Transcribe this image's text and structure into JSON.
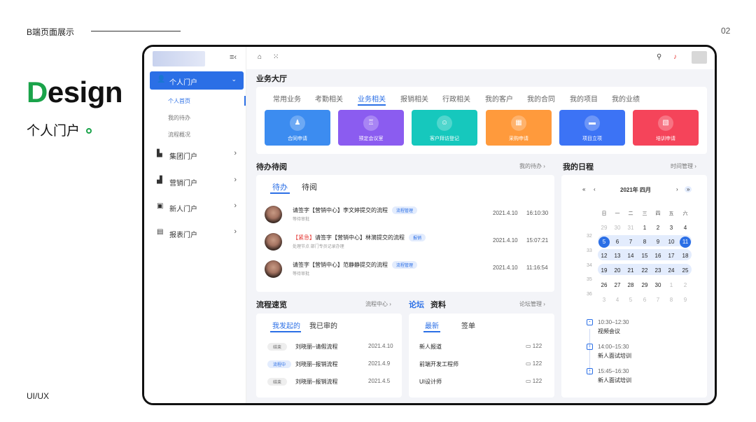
{
  "slide": {
    "title": "B端页面展示",
    "page_num": "02",
    "design_first": "D",
    "design_rest": "esign",
    "subtitle": "个人门户",
    "footer": "UI/UX"
  },
  "sidebar": {
    "active": {
      "label": "个人门户"
    },
    "subitems": [
      {
        "label": "个人首页"
      },
      {
        "label": "我的待办"
      },
      {
        "label": "流程概况"
      }
    ],
    "items": [
      {
        "label": "集团门户"
      },
      {
        "label": "营销门户"
      },
      {
        "label": "新人门户"
      },
      {
        "label": "报表门户"
      }
    ]
  },
  "business": {
    "title": "业务大厅",
    "tabs": [
      "常用业务",
      "考勤相关",
      "业务相关",
      "报销相关",
      "行政相关",
      "我的客户",
      "我的合同",
      "我的项目",
      "我的业绩"
    ],
    "tiles": [
      {
        "label": "合同申请",
        "color": "#3c8cf0"
      },
      {
        "label": "预定会议室",
        "color": "#8b5cf0"
      },
      {
        "label": "客户拜访登记",
        "color": "#16c8bd"
      },
      {
        "label": "采购申请",
        "color": "#ff9a3c"
      },
      {
        "label": "项目立项",
        "color": "#3c73f5"
      },
      {
        "label": "培训申请",
        "color": "#f5445a"
      }
    ]
  },
  "todo": {
    "title": "待办待阅",
    "link": "我的待办",
    "tabs": [
      "待办",
      "待阅"
    ],
    "rows": [
      {
        "prefix": "",
        "title": "请签字【营销中心】李文婷提交的流程",
        "badge": "流程管理",
        "sub": "等待审批",
        "date": "2021.4.10",
        "time": "16:10:30"
      },
      {
        "prefix": "【紧急】",
        "title": "请签字【营销中心】林漪提交的流程",
        "badge": "报销",
        "sub": "处理节点 部门专员记录办理",
        "date": "2021.4.10",
        "time": "15:07:21"
      },
      {
        "prefix": "",
        "title": "请签字【营销中心】范静静提交的流程",
        "badge": "流程管理",
        "sub": "等待审批",
        "date": "2021.4.10",
        "time": "11:16:54"
      }
    ]
  },
  "schedule": {
    "title": "我的日程",
    "link": "时间管理",
    "month": "2021年 四月",
    "nav": {
      "prev_year": "«",
      "prev": "‹",
      "next": "›",
      "next_year": "»"
    },
    "weekdays": [
      "日",
      "一",
      "二",
      "三",
      "四",
      "五",
      "六"
    ],
    "weeks": [
      "32",
      "33",
      "34",
      "35",
      "36"
    ],
    "days": [
      [
        "29",
        "30",
        "31",
        "1",
        "2",
        "3",
        "4"
      ],
      [
        "5",
        "6",
        "7",
        "8",
        "9",
        "10",
        "11"
      ],
      [
        "12",
        "13",
        "14",
        "15",
        "16",
        "17",
        "18"
      ],
      [
        "19",
        "20",
        "21",
        "22",
        "23",
        "24",
        "25"
      ],
      [
        "26",
        "27",
        "28",
        "29",
        "30",
        "1",
        "2"
      ],
      [
        "3",
        "4",
        "5",
        "6",
        "7",
        "8",
        "9"
      ]
    ],
    "events": [
      {
        "time": "10:30–12:30",
        "name": "视频会议"
      },
      {
        "time": "14:00–15:30",
        "name": "新人面试培训"
      },
      {
        "time": "15:45–16:30",
        "name": "新人面试培训"
      }
    ]
  },
  "process": {
    "title": "流程速览",
    "link": "流程中心",
    "tabs": [
      "我发起的",
      "我已审的"
    ],
    "rows": [
      {
        "status": "结束",
        "name": "刘晓丽–请假流程",
        "date": "2021.4.10"
      },
      {
        "status": "流程中",
        "name": "刘晓丽–报销流程",
        "date": "2021.4.9"
      },
      {
        "status": "结束",
        "name": "刘晓丽–报销流程",
        "date": "2021.4.5"
      }
    ]
  },
  "forum": {
    "title_active": "论坛",
    "title_other": "资料",
    "link": "论坛管理",
    "tabs": [
      "最新",
      "签单"
    ],
    "rows": [
      {
        "name": "新人报道",
        "count": "122"
      },
      {
        "name": "前端开发工程师",
        "count": "122"
      },
      {
        "name": "UI设计师",
        "count": "122"
      }
    ]
  }
}
